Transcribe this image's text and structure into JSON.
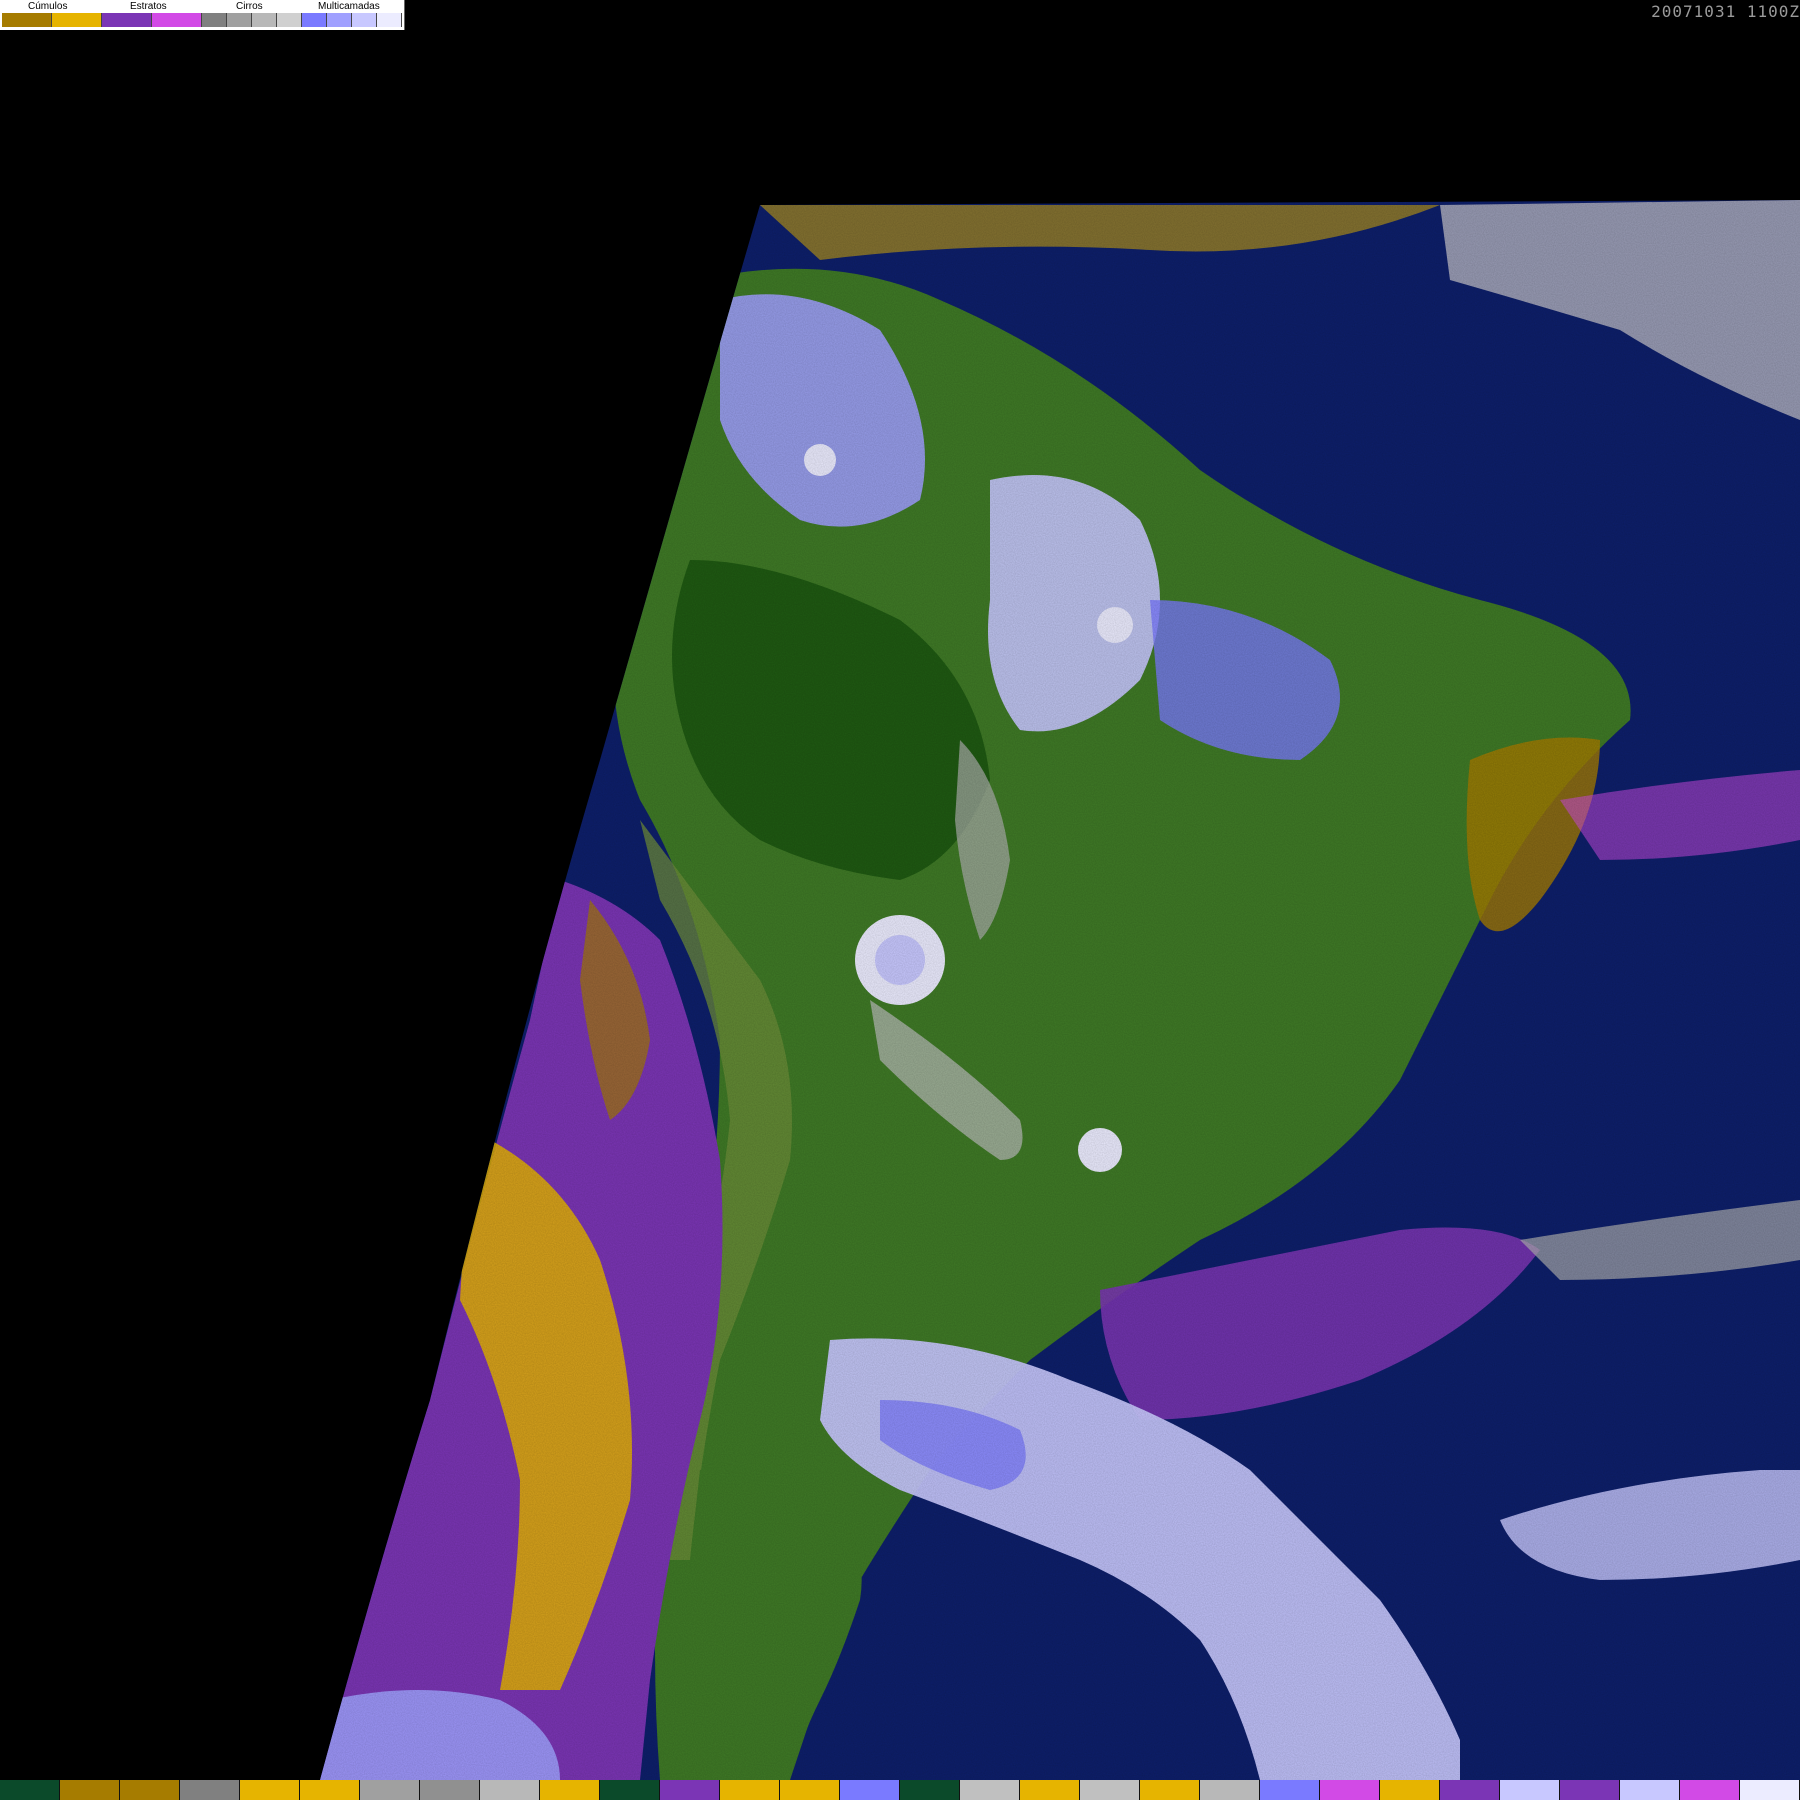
{
  "legend": {
    "categories": [
      {
        "label": "Cúmulos",
        "colors": [
          "#a67c00",
          "#e6b400"
        ]
      },
      {
        "label": "Estratos",
        "colors": [
          "#7b35b5",
          "#d24ae6"
        ]
      },
      {
        "label": "Cirros",
        "colors": [
          "#808080",
          "#a0a0a0",
          "#b8b8b8",
          "#d0d0d0"
        ]
      },
      {
        "label": "Multicamadas",
        "colors": [
          "#7a7aff",
          "#a0a0ff",
          "#c8c8ff",
          "#ececff"
        ]
      }
    ]
  },
  "timestamp": "20071031 1100Z",
  "colors": {
    "background": "#000000",
    "ocean": "#0d1f6b",
    "land_dark": "#1f5a12",
    "land": "#3f7a26",
    "land_light": "#6f8f3a",
    "cumulus_dark": "#a67c00",
    "cumulus": "#e6b400",
    "stratus_dark": "#7b35b5",
    "stratus": "#d24ae6",
    "cirrus": "#b0b0b0",
    "multi_1": "#7a7aff",
    "multi_2": "#a0a0ff",
    "multi_3": "#c8c8ff",
    "multi_4": "#ececff"
  },
  "bottom_strip": [
    "#0b4a2a",
    "#a67c00",
    "#a67c00",
    "#808080",
    "#e6b400",
    "#e6b400",
    "#a0a0a0",
    "#909090",
    "#b8b8b8",
    "#e6b400",
    "#0b4a2a",
    "#7b35b5",
    "#e6b400",
    "#e6b400",
    "#7a7aff",
    "#0b4a2a",
    "#c0c0c0",
    "#e6b400",
    "#c0c0c0",
    "#e6b400",
    "#b8b8b8",
    "#7a7aff",
    "#d24ae6",
    "#e6b400",
    "#7b35b5",
    "#c8c8ff",
    "#7b35b5",
    "#c8c8ff",
    "#d24ae6",
    "#ececff"
  ]
}
